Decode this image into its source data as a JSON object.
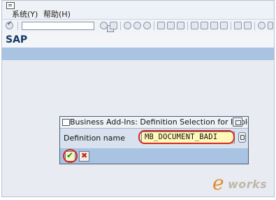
{
  "menubar": {
    "items": [
      {
        "label": "系统(Y)"
      },
      {
        "label": "帮助(H)"
      }
    ]
  },
  "header": {
    "title": "SAP"
  },
  "dialog": {
    "title": "Business Add-Ins: Definition Selection for Implem",
    "field_label": "Definition name",
    "field_value": "MB_DOCUMENT_BADI"
  },
  "icons": {
    "app": "app-menu-icon",
    "enter": "enter-icon",
    "confirm": "checkmark-icon",
    "cancel": "cancel-x-icon",
    "f4": "value-help-icon"
  },
  "colors": {
    "field_bg": "#fff9b8",
    "highlight": "#d62828",
    "title": "#143a66",
    "app_toolbar": "#a9c3e2"
  },
  "watermark": {
    "e": "e",
    "works": "works"
  }
}
